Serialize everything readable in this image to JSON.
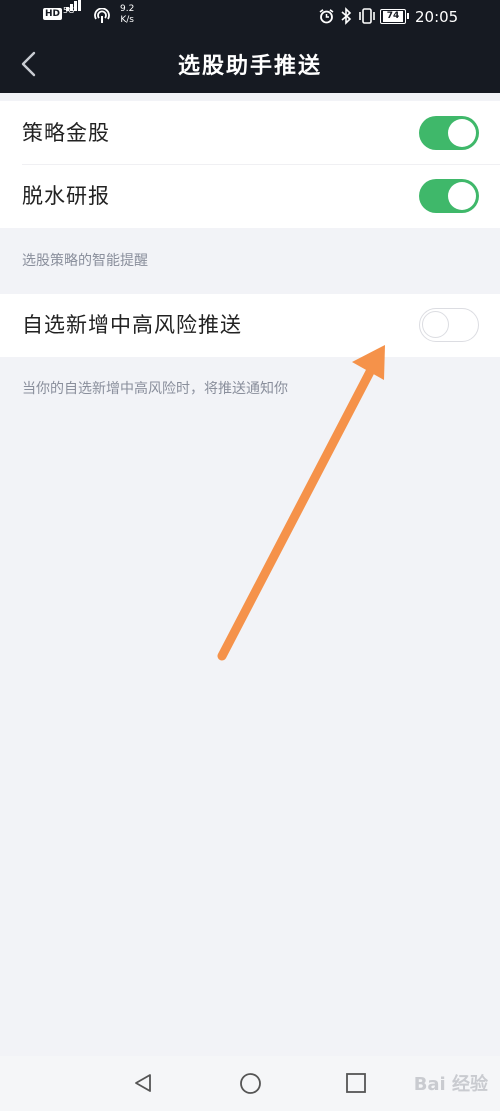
{
  "status_bar": {
    "hd": "HD",
    "network": "5G",
    "speed_value": "9.2",
    "speed_unit": "K/s",
    "battery": "74",
    "time": "20:05"
  },
  "header": {
    "title": "选股助手推送"
  },
  "settings": {
    "group1": [
      {
        "label": "策略金股",
        "enabled": true
      },
      {
        "label": "脱水研报",
        "enabled": true
      }
    ],
    "group1_caption": "选股策略的智能提醒",
    "group2": [
      {
        "label": "自选新增中高风险推送",
        "enabled": false
      }
    ],
    "group2_caption": "当你的自选新增中高风险时，将推送通知你"
  },
  "annotation": {
    "arrow_color": "#f5924a"
  },
  "watermark": "Bai 经验",
  "colors": {
    "toggle_on": "#3fb86a",
    "header_bg": "#161a22",
    "page_bg": "#f2f3f7"
  }
}
